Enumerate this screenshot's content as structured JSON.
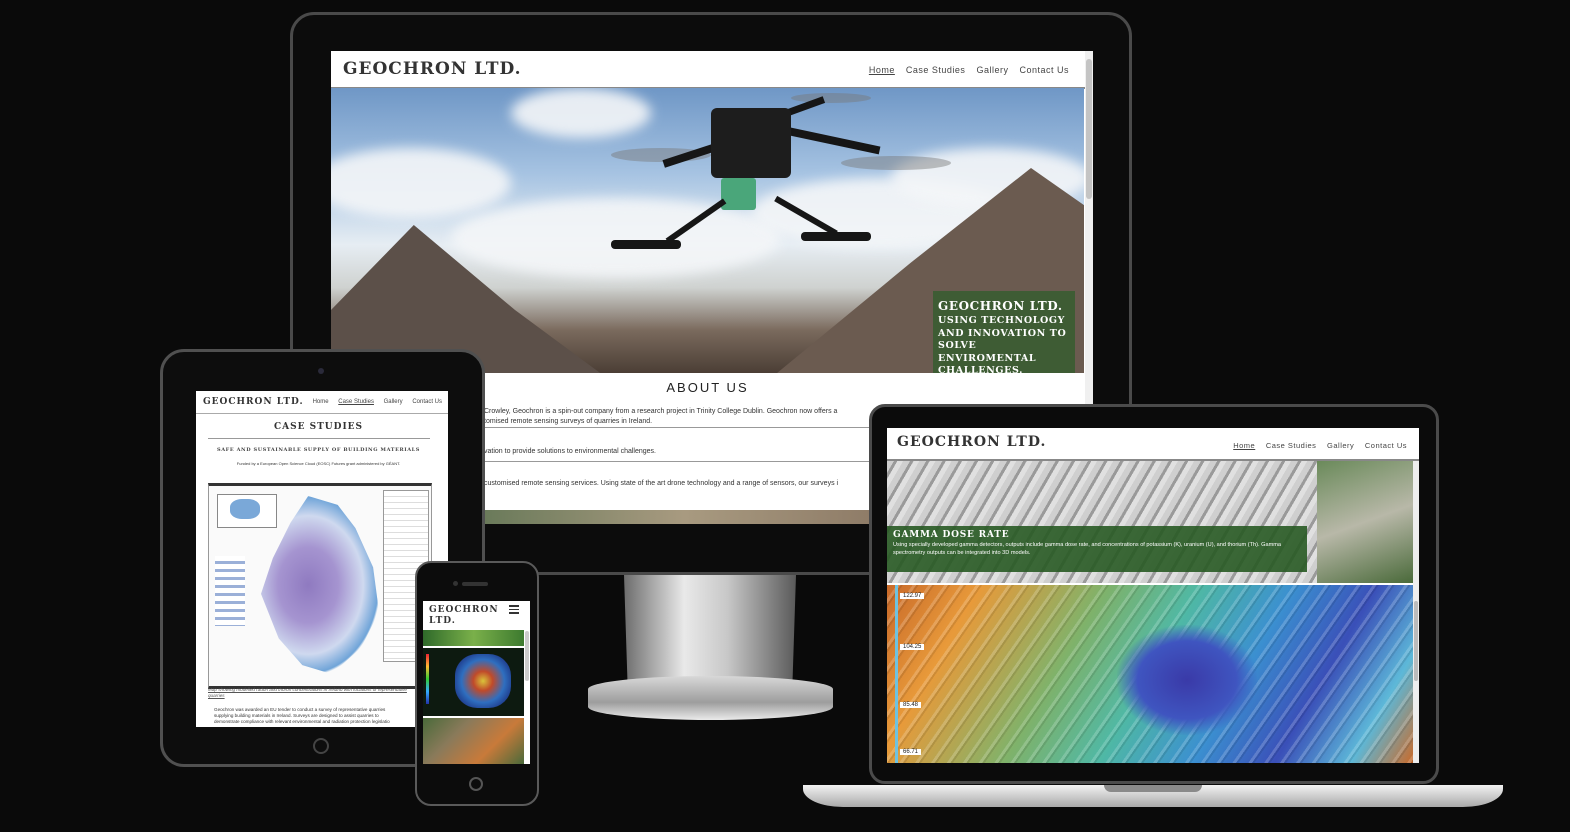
{
  "brand": "GEOCHRON LTD.",
  "nav": {
    "home": "Home",
    "case_studies": "Case Studies",
    "gallery": "Gallery",
    "contact": "Contact Us"
  },
  "desktop": {
    "hero_title": "GEOCHRON LTD.",
    "hero_tagline": "USING TECHNOLOGY AND INNOVATION TO SOLVE ENVIROMENTAL CHALLENGES.",
    "about_heading": "ABOUT US",
    "about_p1_line1": "Crowley, Geochron is a spin-out company from a research project in Trinity College Dublin. Geochron now offers a",
    "about_p1_line2": "tomised remote sensing surveys of quarries in Ireland.",
    "about_p2": "vation to provide solutions to environmental challenges.",
    "about_p3": "customised remote sensing services. Using state of the art drone technology and a range of sensors, our surveys i"
  },
  "tablet": {
    "page_title": "CASE STUDIES",
    "study_title": "SAFE AND SUSTAINABLE SUPPLY OF BUILDING MATERIALS",
    "funding": "Funded by a European Open Science Cloud (EOSC) Futures grant administered by GÉANT.",
    "map_caption": "Map showing modelled radon and thoron concentrations in Ireland with locations of representative quarries",
    "body_line1": "Geochron was awarded an EU tender to conduct a survey of representative quarries",
    "body_line2": "supplying building materials in Ireland. Surveys are designed to assist quarries to",
    "body_line3": "demonstrate compliance with relevant environmental and radiation protection legislatio"
  },
  "phone": {
    "brand_line1": "GEOCHRON",
    "brand_line2": "LTD.",
    "menu_icon": "hamburger-icon"
  },
  "laptop": {
    "card_title": "GAMMA DOSE RATE",
    "card_body": "Using specially developed gamma detectors, outputs include gamma dose rate, and concentrations of potassium (K), uranium (U), and thorium (Th). Gamma spectrometry outputs can be integrated into 3D models.",
    "elev_labels": [
      "122.97",
      "104.25",
      "85.48",
      "66.71"
    ]
  },
  "colors": {
    "background": "#0a0a0a",
    "hero_box": "#385c30",
    "text_dark": "#333333"
  }
}
